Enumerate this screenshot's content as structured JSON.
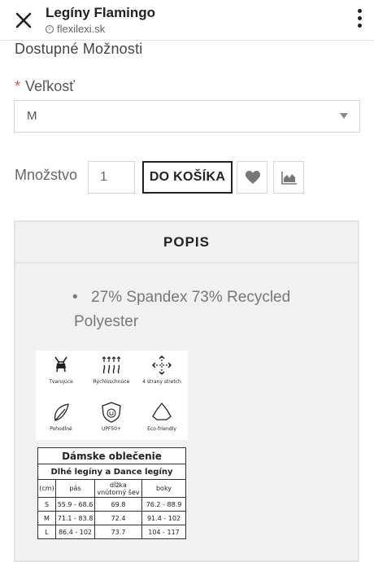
{
  "browser": {
    "title": "Legíny Flamingo",
    "url": "flexilexi.sk",
    "close_icon": "close-icon",
    "menu_icon": "more-vertical-icon"
  },
  "options": {
    "heading": "Dostupné Možnosti",
    "size_label": "Veľkosť",
    "required_mark": "*",
    "size_value": "M"
  },
  "purchase": {
    "quantity_label": "Množstvo",
    "quantity_value": "1",
    "add_to_cart_label": "DO KOŠÍKA",
    "wishlist_icon": "heart-icon",
    "compare_icon": "chart-icon"
  },
  "tabs": {
    "description_label": "POPIS"
  },
  "description": {
    "bullet": "•",
    "text": "27% Spandex 73% Recycled Polyester"
  },
  "features": [
    {
      "label": "Tvarujúce",
      "icon": "shaping-icon"
    },
    {
      "label": "Rýchloschnúce",
      "icon": "quick-dry-icon"
    },
    {
      "label": "4 strany stretch",
      "icon": "stretch-icon"
    },
    {
      "label": "Pohodlné",
      "icon": "feather-icon"
    },
    {
      "label": "UPF50+",
      "icon": "uv-shield-icon"
    },
    {
      "label": "Eco-friendly",
      "icon": "recycle-icon"
    }
  ],
  "size_chart": {
    "title": "Dámske oblečenie",
    "subtitle": "Dlhé legíny a Dance legíny",
    "headers": [
      "(cm)",
      "pás",
      "dĺžka vnútorný šev",
      "boky"
    ],
    "rows": [
      [
        "S",
        "55.9 - 68.6",
        "69.8",
        "76.2 - 88.9"
      ],
      [
        "M",
        "71.1 - 83.8",
        "72.4",
        "91.4 - 102"
      ],
      [
        "L",
        "86.4 - 102",
        "73.7",
        "104 - 117"
      ]
    ]
  }
}
